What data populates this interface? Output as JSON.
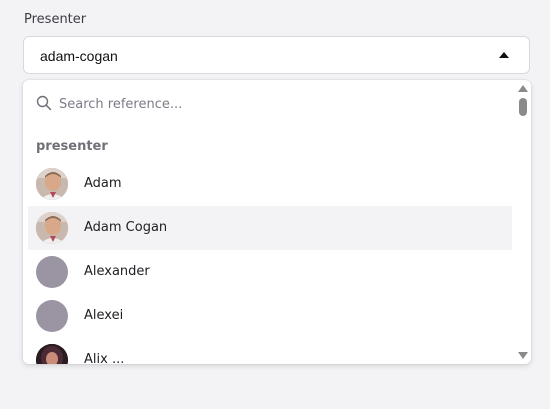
{
  "field": {
    "label": "Presenter"
  },
  "select": {
    "value": "adam-cogan"
  },
  "dropdown": {
    "search_placeholder": "Search reference...",
    "group_heading": "presenter",
    "options": [
      {
        "label": "Adam",
        "avatar": "photo"
      },
      {
        "label": "Adam Cogan",
        "avatar": "photo",
        "hovered": true
      },
      {
        "label": "Alexander",
        "avatar": "placeholder"
      },
      {
        "label": "Alexei",
        "avatar": "placeholder"
      },
      {
        "label": "Alix ...",
        "avatar": "photo-dark"
      }
    ]
  },
  "colors": {
    "background": "#f3f3f6",
    "placeholder_avatar": "#9a94a3",
    "hover_row": "#f3f3f5"
  }
}
